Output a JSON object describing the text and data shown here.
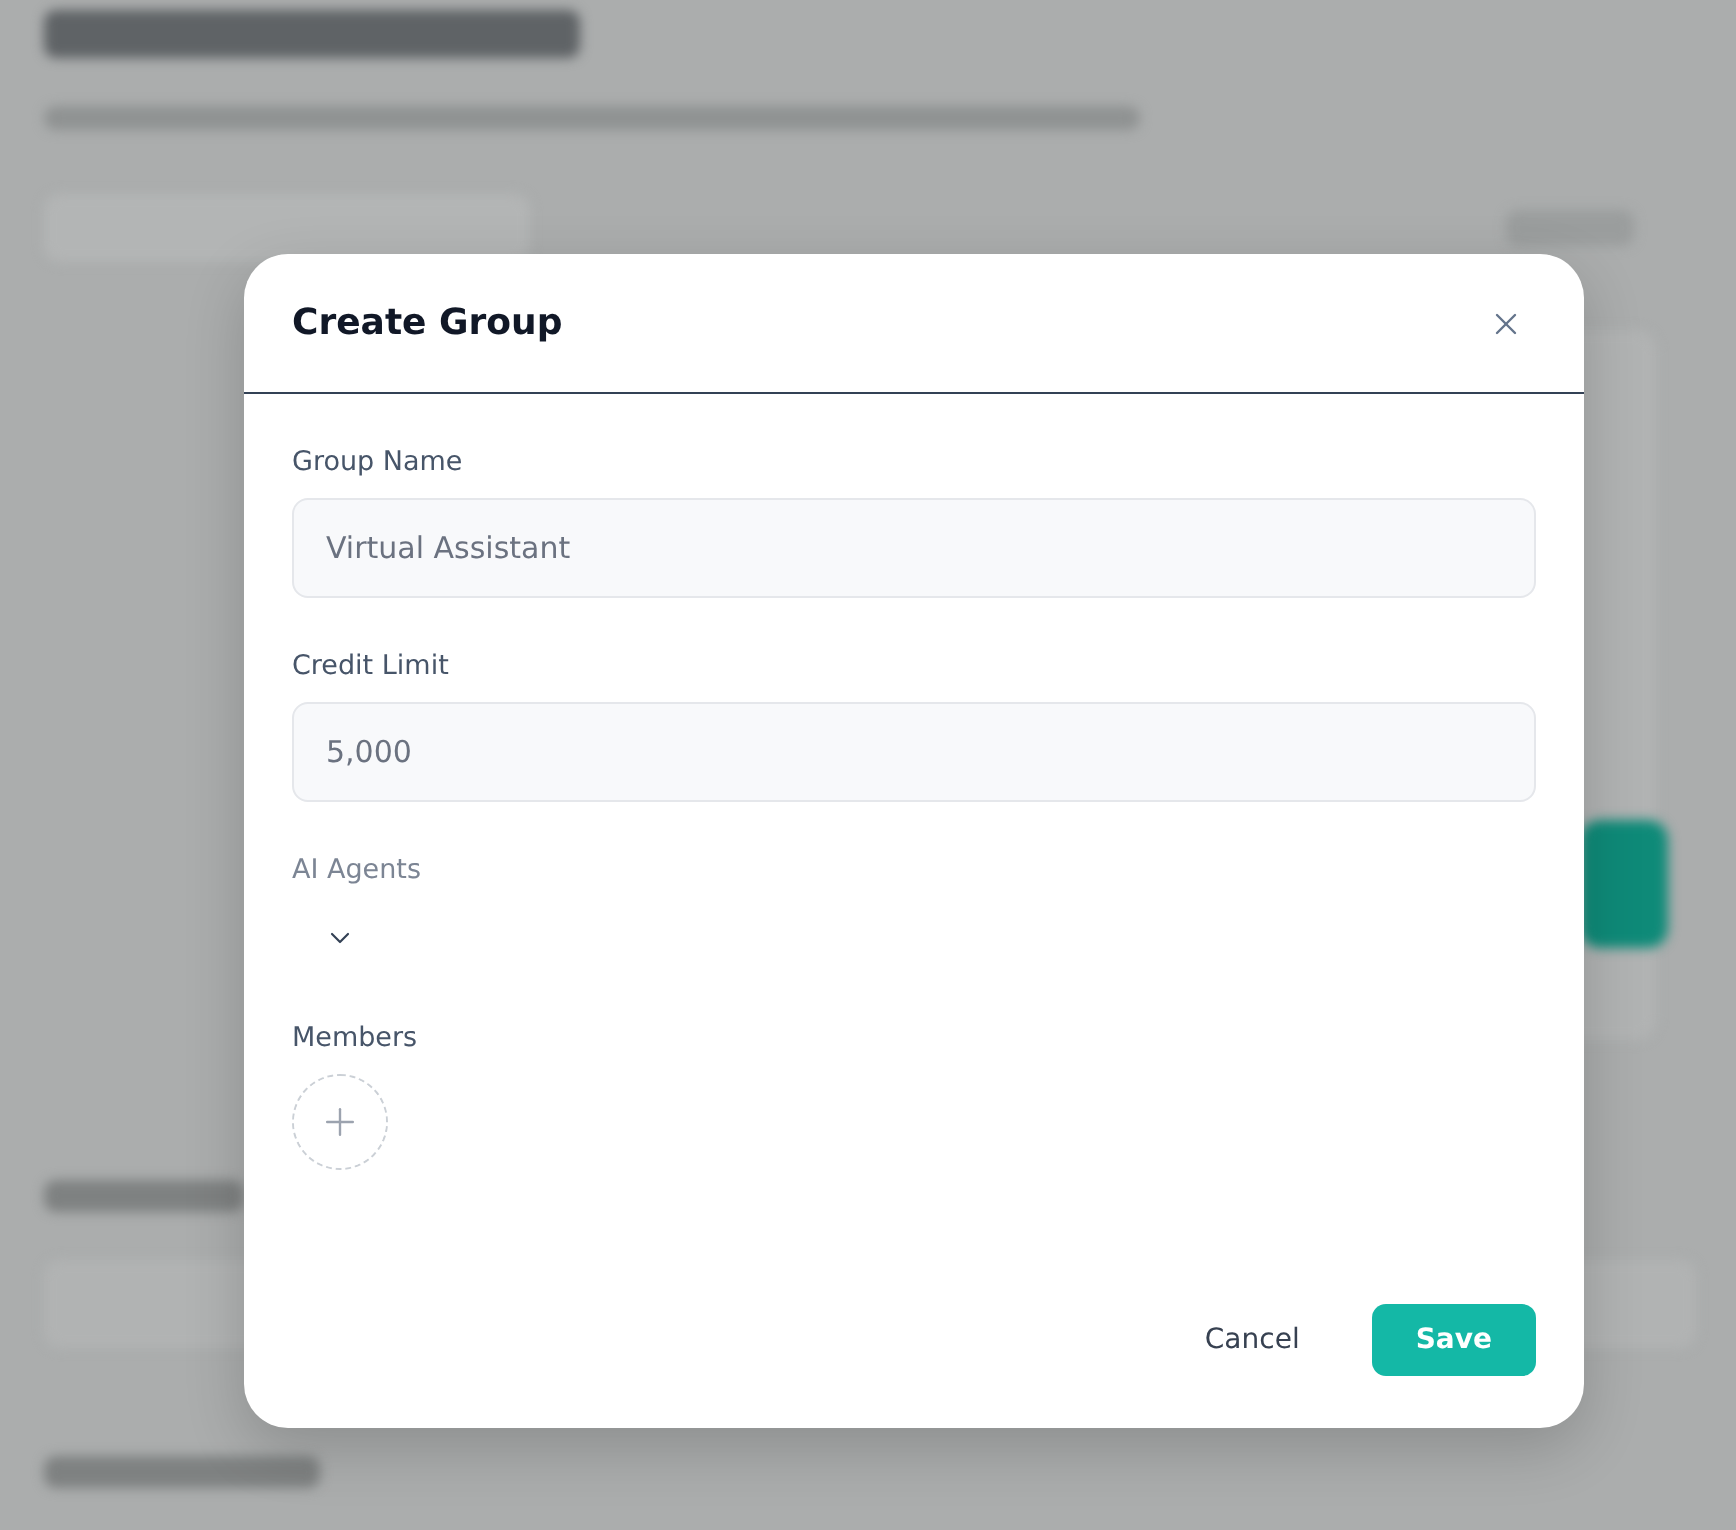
{
  "dialog": {
    "title": "Create Group",
    "fields": [
      {
        "kind": "text",
        "label": "Group Name",
        "value": "Virtual Assistant"
      },
      {
        "kind": "text",
        "label": "Credit Limit",
        "value": "5,000"
      },
      {
        "kind": "select",
        "label": "AI Agents",
        "expanded": false
      },
      {
        "kind": "members",
        "label": "Members"
      }
    ],
    "buttons": [
      {
        "kind": "secondary",
        "label": "Cancel"
      },
      {
        "kind": "primary",
        "label": "Save"
      }
    ]
  }
}
